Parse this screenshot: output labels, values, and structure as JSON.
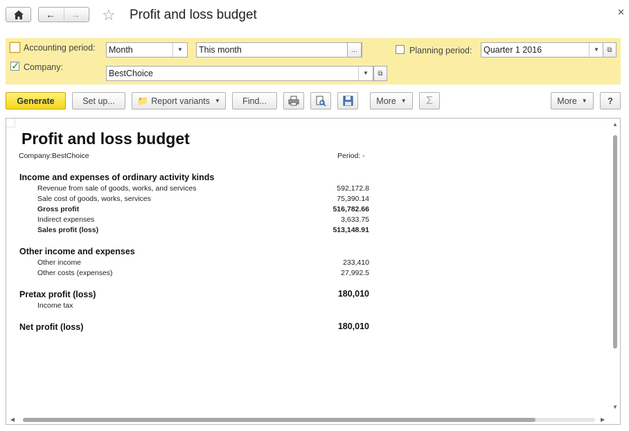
{
  "window": {
    "title": "Profit and loss budget"
  },
  "filters": {
    "accounting_period_label": "Accounting period:",
    "accounting_period_type": "Month",
    "accounting_period_value": "This month",
    "accounting_period_checked": false,
    "company_label": "Company:",
    "company_checked": true,
    "company_value": "BestChoice",
    "planning_period_label": "Planning period:",
    "planning_period_checked": false,
    "planning_period_value": "Quarter 1 2016",
    "ellipsis": "..."
  },
  "toolbar": {
    "generate": "Generate",
    "setup": "Set up...",
    "report_variants": "Report variants",
    "find": "Find...",
    "more1": "More",
    "more2": "More",
    "help": "?",
    "sum": "Σ"
  },
  "report": {
    "title": "Profit and loss budget",
    "company_line": "Company:BestChoice",
    "period_line": "Period:  -",
    "sections": [
      {
        "heading": "Income and expenses of ordinary activity kinds",
        "rows": [
          {
            "label": "Revenue from sale of goods, works, and services",
            "value": "592,172.8",
            "bold": false
          },
          {
            "label": "Sale cost of goods, works, services",
            "value": "75,390.14",
            "bold": false
          },
          {
            "label": "Gross profit",
            "value": "516,782.66",
            "bold": true
          },
          {
            "label": "Indirect expenses",
            "value": "3,633.75",
            "bold": false
          },
          {
            "label": "Sales profit (loss)",
            "value": "513,148.91",
            "bold": true
          }
        ]
      },
      {
        "heading": "Other income and expenses",
        "rows": [
          {
            "label": "Other income",
            "value": "233,410",
            "bold": false
          },
          {
            "label": "Other costs (expenses)",
            "value": "27,992.5",
            "bold": false
          }
        ]
      }
    ],
    "pretax": {
      "label": "Pretax profit (loss)",
      "value": "180,010"
    },
    "income_tax": "Income tax",
    "net": {
      "label": "Net profit (loss)",
      "value": "180,010"
    }
  },
  "colors": {
    "filter_panel": "#fbeea4",
    "primary_button": "#f3d61f"
  }
}
